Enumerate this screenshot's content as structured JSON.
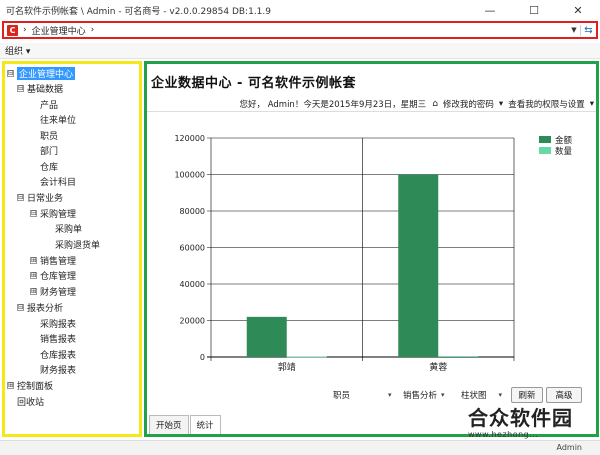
{
  "window": {
    "title": "可名软件示例帐套 \\ Admin - 可名商号 - v2.0.0.29854  DB:1.1.9",
    "minimize": "—",
    "maximize": "☐",
    "close": "✕"
  },
  "address": {
    "app_icon": "C",
    "arrow1": "›",
    "segment": "企业管理中心",
    "arrow2": "›",
    "dropdown": "▼",
    "refresh": "⇆"
  },
  "menubar": {
    "org": "组织 ▾"
  },
  "tree": [
    {
      "label": "企业管理中心",
      "exp": "⊟",
      "selected": true
    },
    {
      "label": "基础数据",
      "exp": "⊟"
    },
    {
      "label": "产品"
    },
    {
      "label": "往来单位"
    },
    {
      "label": "职员"
    },
    {
      "label": "部门"
    },
    {
      "label": "仓库"
    },
    {
      "label": "会计科目"
    },
    {
      "label": "日常业务",
      "exp": "⊟"
    },
    {
      "label": "采购管理",
      "exp": "⊟"
    },
    {
      "label": "采购单"
    },
    {
      "label": "采购退货单"
    },
    {
      "label": "销售管理",
      "exp": "⊞"
    },
    {
      "label": "仓库管理",
      "exp": "⊞"
    },
    {
      "label": "财务管理",
      "exp": "⊞"
    },
    {
      "label": "报表分析",
      "exp": "⊟"
    },
    {
      "label": "采购报表"
    },
    {
      "label": "销售报表"
    },
    {
      "label": "仓库报表"
    },
    {
      "label": "财务报表"
    },
    {
      "label": "控制面板",
      "exp": "⊞"
    },
    {
      "label": "回收站"
    }
  ],
  "content": {
    "title": "企业数据中心 - 可名软件示例帐套",
    "greeting": "您好， Admin！今天是2015年9月23日，星期三",
    "change_password": "修改我的密码",
    "view_permissions": "查看我的权限与设置"
  },
  "chart_data": {
    "type": "bar",
    "categories": [
      "郭靖",
      "黄蓉"
    ],
    "series": [
      {
        "name": "金额",
        "values": [
          22000,
          100000
        ],
        "color": "#2e8b57"
      },
      {
        "name": "数量",
        "values": [
          300,
          500
        ],
        "color": "#66d9a6"
      }
    ],
    "ylim": [
      0,
      120000
    ],
    "yticks": [
      "0",
      "20000",
      "40000",
      "60000",
      "80000",
      "100000",
      "120000"
    ],
    "legend": "top-right",
    "grid": true
  },
  "controls": {
    "staff": "职员",
    "sales_analysis": "销售分析",
    "bar_chart": "柱状图",
    "refresh": "刷新",
    "advanced": "高级",
    "dd": "▾"
  },
  "tabs": [
    {
      "label": "开始页"
    },
    {
      "label": "统计"
    }
  ],
  "watermark": {
    "title": "合众软件园",
    "url": "www.hezhong..."
  },
  "status": {
    "user": "Admin"
  }
}
